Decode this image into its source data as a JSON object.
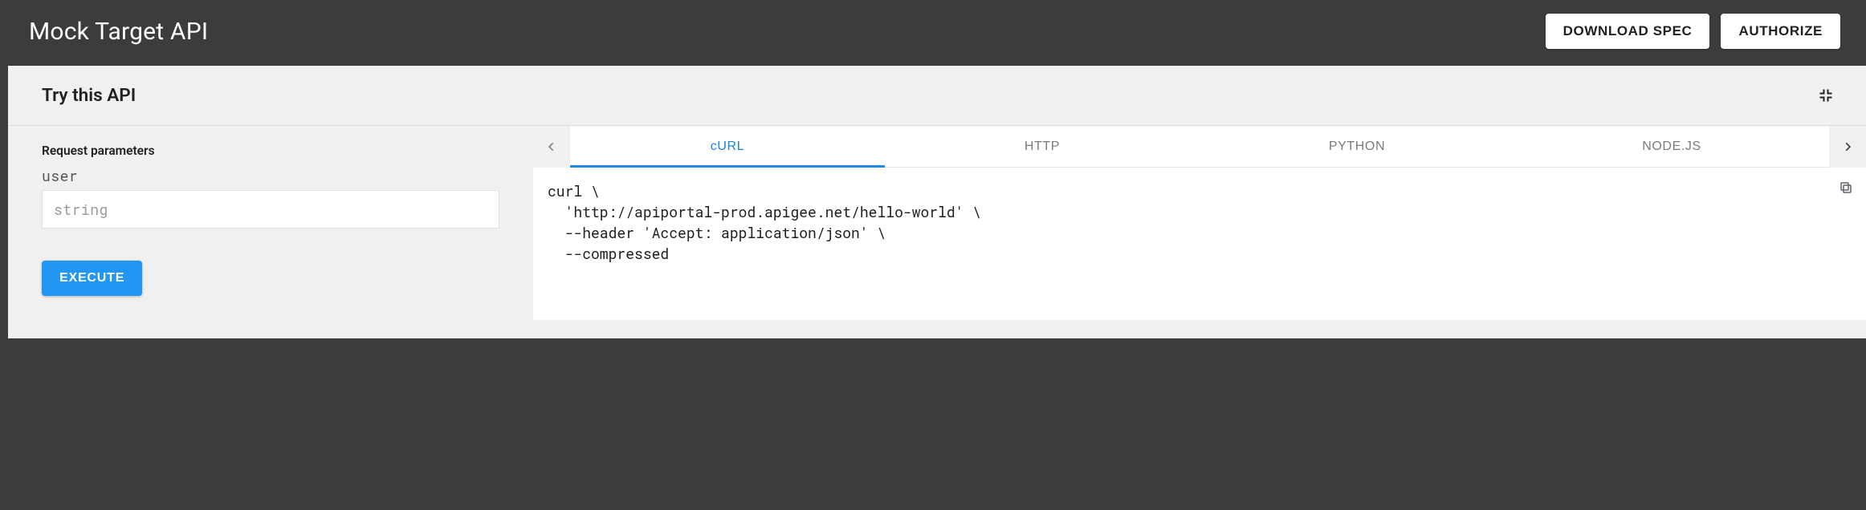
{
  "header": {
    "title": "Mock Target API",
    "download_spec_label": "DOWNLOAD SPEC",
    "authorize_label": "AUTHORIZE"
  },
  "panel": {
    "title": "Try this API",
    "collapse_icon": "contract-icon"
  },
  "request": {
    "heading": "Request parameters",
    "params": {
      "user": {
        "name": "user",
        "placeholder": "string"
      }
    },
    "execute_label": "EXECUTE"
  },
  "code": {
    "scroll_prev": "‹",
    "scroll_next": "›",
    "tabs": [
      {
        "label": "cURL",
        "active": true
      },
      {
        "label": "HTTP",
        "active": false
      },
      {
        "label": "PYTHON",
        "active": false
      },
      {
        "label": "NODE.JS",
        "active": false
      }
    ],
    "snippet": "curl \\\n  'http://apiportal-prod.apigee.net/hello-world' \\\n  --header 'Accept: application/json' \\\n  --compressed"
  },
  "colors": {
    "topbar_bg": "#3c3c3c",
    "panel_bg": "#f0f0f0",
    "accent": "#2196f3",
    "active_tab": "#1e88e5"
  }
}
